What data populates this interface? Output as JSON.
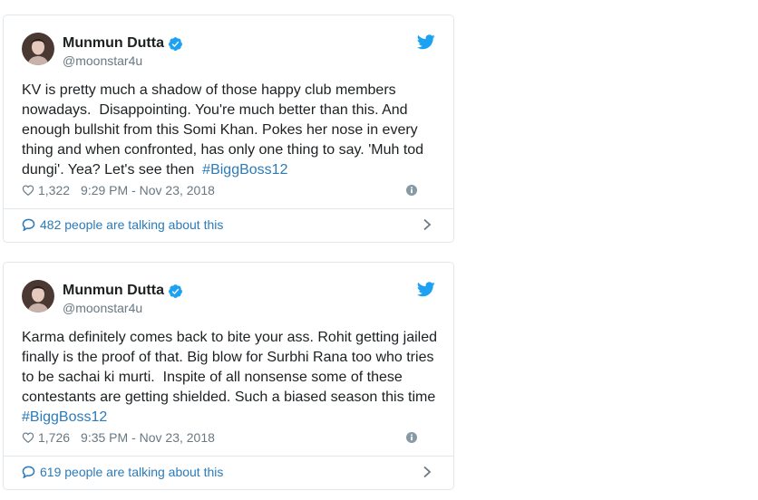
{
  "colors": {
    "brand": "#1da1f2",
    "link": "#2b7bb9",
    "text": "#1c2022",
    "muted": "#697882",
    "border": "#e1e8ed"
  },
  "icons": {
    "brand": "twitter-bird-icon",
    "verified": "verified-badge-icon",
    "like": "heart-icon",
    "info": "info-icon",
    "conversation": "speech-bubble-icon",
    "open": "chevron-right-icon"
  },
  "tweets": [
    {
      "author": {
        "name": "Munmun Dutta",
        "handle": "@moonstar4u",
        "verified": true
      },
      "text": "KV is pretty much a shadow of those happy club members nowadays.  Disappointing. You're much better than this. And enough bullshit from this Somi Khan. Pokes her nose in every thing and when confronted, has only one thing to say. 'Muh tod dungi'. Yea? Let's see then  ",
      "hashtag": "#BiggBoss12",
      "likes": "1,322",
      "timestamp": "9:29 PM - Nov 23, 2018",
      "talking": "482 people are talking about this"
    },
    {
      "author": {
        "name": "Munmun Dutta",
        "handle": "@moonstar4u",
        "verified": true
      },
      "text": "Karma definitely comes back to bite your ass. Rohit getting jailed finally is the proof of that. Big blow for Surbhi Rana too who tries to be sachai ki murti.  Inspite of all nonsense some of these contestants are getting shielded. Such a biased season this time\n",
      "hashtag": "#BiggBoss12",
      "likes": "1,726",
      "timestamp": "9:35 PM - Nov 23, 2018",
      "talking": "619 people are talking about this"
    }
  ]
}
